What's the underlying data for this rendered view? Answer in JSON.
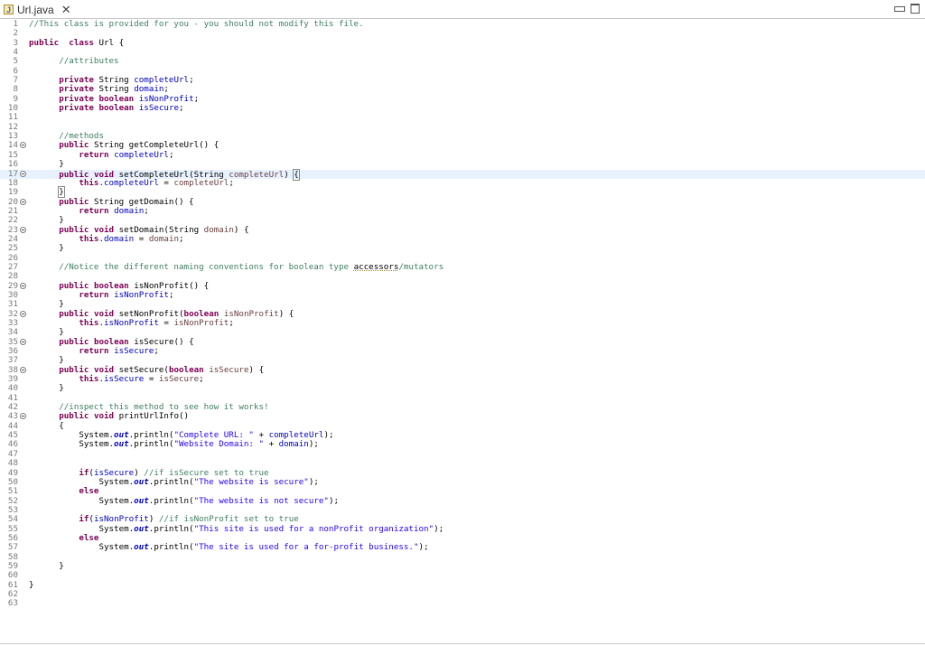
{
  "tab": {
    "file_name": "Url.java",
    "icon": "java-file-icon",
    "close": "✕"
  },
  "window_controls": {
    "minimize": "minimize-icon",
    "maximize": "maximize-icon"
  },
  "colors": {
    "keyword": "#7f0055",
    "comment": "#3f7f5f",
    "field": "#0000c0",
    "string": "#2a00ff",
    "param": "#6a3e3e",
    "current_line": "#e8f2fe"
  },
  "editor": {
    "current_line": 17,
    "lines": [
      {
        "n": "1",
        "fold": false,
        "tokens": [
          [
            "cm",
            "//This class is provided for you - you should not modify this file."
          ]
        ]
      },
      {
        "n": "2",
        "fold": false,
        "tokens": []
      },
      {
        "n": "3",
        "fold": false,
        "tokens": [
          [
            "kw",
            "public"
          ],
          [
            "",
            "  "
          ],
          [
            "kw",
            "class"
          ],
          [
            "",
            " Url {"
          ]
        ]
      },
      {
        "n": "4",
        "fold": false,
        "tokens": []
      },
      {
        "n": "5",
        "fold": false,
        "tokens": [
          [
            "",
            "      "
          ],
          [
            "cm",
            "//attributes"
          ]
        ]
      },
      {
        "n": "6",
        "fold": false,
        "tokens": []
      },
      {
        "n": "7",
        "fold": false,
        "tokens": [
          [
            "",
            "      "
          ],
          [
            "kw",
            "private"
          ],
          [
            "",
            " String "
          ],
          [
            "fd",
            "completeUrl"
          ],
          [
            "",
            ";"
          ]
        ]
      },
      {
        "n": "8",
        "fold": false,
        "tokens": [
          [
            "",
            "      "
          ],
          [
            "kw",
            "private"
          ],
          [
            "",
            " String "
          ],
          [
            "fd",
            "domain"
          ],
          [
            "",
            ";"
          ]
        ]
      },
      {
        "n": "9",
        "fold": false,
        "tokens": [
          [
            "",
            "      "
          ],
          [
            "kw",
            "private"
          ],
          [
            "",
            " "
          ],
          [
            "kw",
            "boolean"
          ],
          [
            "",
            " "
          ],
          [
            "fd",
            "isNonProfit"
          ],
          [
            "",
            ";"
          ]
        ]
      },
      {
        "n": "10",
        "fold": false,
        "tokens": [
          [
            "",
            "      "
          ],
          [
            "kw",
            "private"
          ],
          [
            "",
            " "
          ],
          [
            "kw",
            "boolean"
          ],
          [
            "",
            " "
          ],
          [
            "fd",
            "isSecure"
          ],
          [
            "",
            ";"
          ]
        ]
      },
      {
        "n": "11",
        "fold": false,
        "tokens": []
      },
      {
        "n": "12",
        "fold": false,
        "tokens": []
      },
      {
        "n": "13",
        "fold": false,
        "tokens": [
          [
            "",
            "      "
          ],
          [
            "cm",
            "//methods"
          ]
        ]
      },
      {
        "n": "14",
        "fold": true,
        "tokens": [
          [
            "",
            "      "
          ],
          [
            "kw",
            "public"
          ],
          [
            "",
            " String getCompleteUrl() {"
          ]
        ]
      },
      {
        "n": "15",
        "fold": false,
        "tokens": [
          [
            "",
            "          "
          ],
          [
            "kw",
            "return"
          ],
          [
            "",
            " "
          ],
          [
            "fd",
            "completeUrl"
          ],
          [
            "",
            ";"
          ]
        ]
      },
      {
        "n": "16",
        "fold": false,
        "tokens": [
          [
            "",
            "      }"
          ]
        ]
      },
      {
        "n": "17",
        "fold": true,
        "tokens": [
          [
            "",
            "      "
          ],
          [
            "kw",
            "public"
          ],
          [
            "",
            " "
          ],
          [
            "kw",
            "void"
          ],
          [
            "",
            " setCompleteUrl(String "
          ],
          [
            "pm",
            "completeUrl"
          ],
          [
            "",
            ") "
          ],
          [
            "bm",
            "{"
          ],
          [
            "caret",
            ""
          ]
        ]
      },
      {
        "n": "18",
        "fold": false,
        "tokens": [
          [
            "",
            "          "
          ],
          [
            "kw",
            "this"
          ],
          [
            "",
            "."
          ],
          [
            "fd",
            "completeUrl"
          ],
          [
            "",
            " = "
          ],
          [
            "pm",
            "completeUrl"
          ],
          [
            "",
            ";"
          ]
        ]
      },
      {
        "n": "19",
        "fold": false,
        "tokens": [
          [
            "",
            "      "
          ],
          [
            "bm",
            "}"
          ]
        ]
      },
      {
        "n": "20",
        "fold": true,
        "tokens": [
          [
            "",
            "      "
          ],
          [
            "kw",
            "public"
          ],
          [
            "",
            " String getDomain() {"
          ]
        ]
      },
      {
        "n": "21",
        "fold": false,
        "tokens": [
          [
            "",
            "          "
          ],
          [
            "kw",
            "return"
          ],
          [
            "",
            " "
          ],
          [
            "fd",
            "domain"
          ],
          [
            "",
            ";"
          ]
        ]
      },
      {
        "n": "22",
        "fold": false,
        "tokens": [
          [
            "",
            "      }"
          ]
        ]
      },
      {
        "n": "23",
        "fold": true,
        "tokens": [
          [
            "",
            "      "
          ],
          [
            "kw",
            "public"
          ],
          [
            "",
            " "
          ],
          [
            "kw",
            "void"
          ],
          [
            "",
            " setDomain(String "
          ],
          [
            "pm",
            "domain"
          ],
          [
            "",
            ") {"
          ]
        ]
      },
      {
        "n": "24",
        "fold": false,
        "tokens": [
          [
            "",
            "          "
          ],
          [
            "kw",
            "this"
          ],
          [
            "",
            "."
          ],
          [
            "fd",
            "domain"
          ],
          [
            "",
            " = "
          ],
          [
            "pm",
            "domain"
          ],
          [
            "",
            ";"
          ]
        ]
      },
      {
        "n": "25",
        "fold": false,
        "tokens": [
          [
            "",
            "      }"
          ]
        ]
      },
      {
        "n": "26",
        "fold": false,
        "tokens": []
      },
      {
        "n": "27",
        "fold": false,
        "tokens": [
          [
            "",
            "      "
          ],
          [
            "cm",
            "//Notice the different naming conventions for boolean type "
          ],
          [
            "ul",
            "accessors"
          ],
          [
            "cm",
            "/mutators"
          ]
        ]
      },
      {
        "n": "28",
        "fold": false,
        "tokens": []
      },
      {
        "n": "29",
        "fold": true,
        "tokens": [
          [
            "",
            "      "
          ],
          [
            "kw",
            "public"
          ],
          [
            "",
            " "
          ],
          [
            "kw",
            "boolean"
          ],
          [
            "",
            " isNonProfit() {"
          ]
        ]
      },
      {
        "n": "30",
        "fold": false,
        "tokens": [
          [
            "",
            "          "
          ],
          [
            "kw",
            "return"
          ],
          [
            "",
            " "
          ],
          [
            "fd",
            "isNonProfit"
          ],
          [
            "",
            ";"
          ]
        ]
      },
      {
        "n": "31",
        "fold": false,
        "tokens": [
          [
            "",
            "      }"
          ]
        ]
      },
      {
        "n": "32",
        "fold": true,
        "tokens": [
          [
            "",
            "      "
          ],
          [
            "kw",
            "public"
          ],
          [
            "",
            " "
          ],
          [
            "kw",
            "void"
          ],
          [
            "",
            " setNonProfit("
          ],
          [
            "kw",
            "boolean"
          ],
          [
            "",
            " "
          ],
          [
            "pm",
            "isNonProfit"
          ],
          [
            "",
            ") {"
          ]
        ]
      },
      {
        "n": "33",
        "fold": false,
        "tokens": [
          [
            "",
            "          "
          ],
          [
            "kw",
            "this"
          ],
          [
            "",
            "."
          ],
          [
            "fd",
            "isNonProfit"
          ],
          [
            "",
            " = "
          ],
          [
            "pm",
            "isNonProfit"
          ],
          [
            "",
            ";"
          ]
        ]
      },
      {
        "n": "34",
        "fold": false,
        "tokens": [
          [
            "",
            "      }"
          ]
        ]
      },
      {
        "n": "35",
        "fold": true,
        "tokens": [
          [
            "",
            "      "
          ],
          [
            "kw",
            "public"
          ],
          [
            "",
            " "
          ],
          [
            "kw",
            "boolean"
          ],
          [
            "",
            " isSecure() {"
          ]
        ]
      },
      {
        "n": "36",
        "fold": false,
        "tokens": [
          [
            "",
            "          "
          ],
          [
            "kw",
            "return"
          ],
          [
            "",
            " "
          ],
          [
            "fd",
            "isSecure"
          ],
          [
            "",
            ";"
          ]
        ]
      },
      {
        "n": "37",
        "fold": false,
        "tokens": [
          [
            "",
            "      }"
          ]
        ]
      },
      {
        "n": "38",
        "fold": true,
        "tokens": [
          [
            "",
            "      "
          ],
          [
            "kw",
            "public"
          ],
          [
            "",
            " "
          ],
          [
            "kw",
            "void"
          ],
          [
            "",
            " setSecure("
          ],
          [
            "kw",
            "boolean"
          ],
          [
            "",
            " "
          ],
          [
            "pm",
            "isSecure"
          ],
          [
            "",
            ") {"
          ]
        ]
      },
      {
        "n": "39",
        "fold": false,
        "tokens": [
          [
            "",
            "          "
          ],
          [
            "kw",
            "this"
          ],
          [
            "",
            "."
          ],
          [
            "fd",
            "isSecure"
          ],
          [
            "",
            " = "
          ],
          [
            "pm",
            "isSecure"
          ],
          [
            "",
            ";"
          ]
        ]
      },
      {
        "n": "40",
        "fold": false,
        "tokens": [
          [
            "",
            "      }"
          ]
        ]
      },
      {
        "n": "41",
        "fold": false,
        "tokens": []
      },
      {
        "n": "42",
        "fold": false,
        "tokens": [
          [
            "",
            "      "
          ],
          [
            "cm",
            "//inspect this method to see how it works!"
          ]
        ]
      },
      {
        "n": "43",
        "fold": true,
        "tokens": [
          [
            "",
            "      "
          ],
          [
            "kw",
            "public"
          ],
          [
            "",
            " "
          ],
          [
            "kw",
            "void"
          ],
          [
            "",
            " printUrlInfo()"
          ]
        ]
      },
      {
        "n": "44",
        "fold": false,
        "tokens": [
          [
            "",
            "      {"
          ]
        ]
      },
      {
        "n": "45",
        "fold": false,
        "tokens": [
          [
            "",
            "          System."
          ],
          [
            "sf",
            "out"
          ],
          [
            "",
            ".println("
          ],
          [
            "st",
            "\"Complete URL: \""
          ],
          [
            "",
            " + "
          ],
          [
            "fd",
            "completeUrl"
          ],
          [
            "",
            ");"
          ]
        ]
      },
      {
        "n": "46",
        "fold": false,
        "tokens": [
          [
            "",
            "          System."
          ],
          [
            "sf",
            "out"
          ],
          [
            "",
            ".println("
          ],
          [
            "st",
            "\"Website Domain: \""
          ],
          [
            "",
            " + "
          ],
          [
            "fd",
            "domain"
          ],
          [
            "",
            ");"
          ]
        ]
      },
      {
        "n": "47",
        "fold": false,
        "tokens": []
      },
      {
        "n": "48",
        "fold": false,
        "tokens": []
      },
      {
        "n": "49",
        "fold": false,
        "tokens": [
          [
            "",
            "          "
          ],
          [
            "kw",
            "if"
          ],
          [
            "",
            "("
          ],
          [
            "fd",
            "isSecure"
          ],
          [
            "",
            ") "
          ],
          [
            "cm",
            "//if isSecure set to true"
          ]
        ]
      },
      {
        "n": "50",
        "fold": false,
        "tokens": [
          [
            "",
            "              System."
          ],
          [
            "sf",
            "out"
          ],
          [
            "",
            ".println("
          ],
          [
            "st",
            "\"The website is secure\""
          ],
          [
            "",
            ");"
          ]
        ]
      },
      {
        "n": "51",
        "fold": false,
        "tokens": [
          [
            "",
            "          "
          ],
          [
            "kw",
            "else"
          ]
        ]
      },
      {
        "n": "52",
        "fold": false,
        "tokens": [
          [
            "",
            "              System."
          ],
          [
            "sf",
            "out"
          ],
          [
            "",
            ".println("
          ],
          [
            "st",
            "\"The website is not secure\""
          ],
          [
            "",
            ");"
          ]
        ]
      },
      {
        "n": "53",
        "fold": false,
        "tokens": []
      },
      {
        "n": "54",
        "fold": false,
        "tokens": [
          [
            "",
            "          "
          ],
          [
            "kw",
            "if"
          ],
          [
            "",
            "("
          ],
          [
            "fd",
            "isNonProfit"
          ],
          [
            "",
            ") "
          ],
          [
            "cm",
            "//if isNonProfit set to true"
          ]
        ]
      },
      {
        "n": "55",
        "fold": false,
        "tokens": [
          [
            "",
            "              System."
          ],
          [
            "sf",
            "out"
          ],
          [
            "",
            ".println("
          ],
          [
            "st",
            "\"This site is used for a nonProfit organization\""
          ],
          [
            "",
            ");"
          ]
        ]
      },
      {
        "n": "56",
        "fold": false,
        "tokens": [
          [
            "",
            "          "
          ],
          [
            "kw",
            "else"
          ]
        ]
      },
      {
        "n": "57",
        "fold": false,
        "tokens": [
          [
            "",
            "              System."
          ],
          [
            "sf",
            "out"
          ],
          [
            "",
            ".println("
          ],
          [
            "st",
            "\"The site is used for a for-profit business.\""
          ],
          [
            "",
            ");"
          ]
        ]
      },
      {
        "n": "58",
        "fold": false,
        "tokens": []
      },
      {
        "n": "59",
        "fold": false,
        "tokens": [
          [
            "",
            "      }"
          ]
        ]
      },
      {
        "n": "60",
        "fold": false,
        "tokens": []
      },
      {
        "n": "61",
        "fold": false,
        "tokens": [
          [
            "",
            "}"
          ]
        ]
      },
      {
        "n": "62",
        "fold": false,
        "tokens": []
      },
      {
        "n": "63",
        "fold": false,
        "tokens": []
      }
    ]
  }
}
